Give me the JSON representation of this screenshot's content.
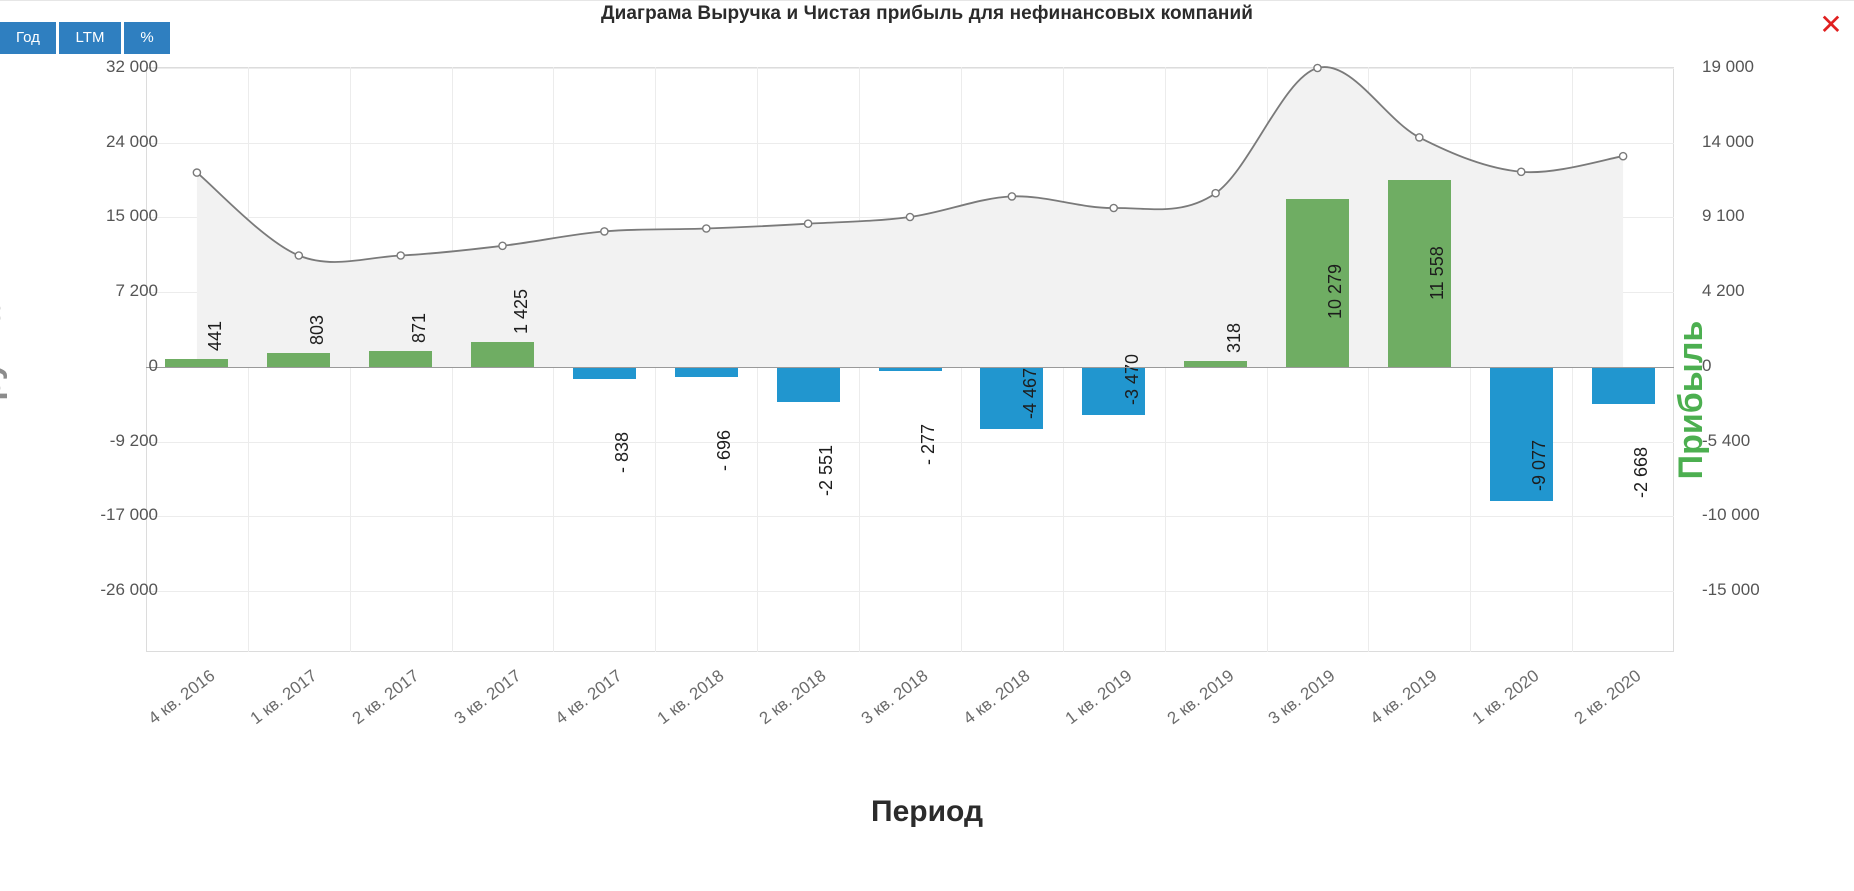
{
  "window": {
    "close_label": "✕"
  },
  "toolbar": {
    "buttons": [
      {
        "label": "Год"
      },
      {
        "label": "LTM"
      },
      {
        "label": "%"
      }
    ],
    "accent_color": "#2f7fc0"
  },
  "chart_data": {
    "type": "bar",
    "title": "Диаграма Выручка и Чистая прибыль для нефинансовых компаний",
    "xlabel": "Период",
    "ylabel": "Выручка",
    "ylabel_secondary": "Прибыль",
    "categories": [
      "4 кв. 2016",
      "1 кв. 2017",
      "2 кв. 2017",
      "3 кв. 2017",
      "4 кв. 2017",
      "1 кв. 2018",
      "2 кв. 2018",
      "3 кв. 2018",
      "4 кв. 2018",
      "1 кв. 2019",
      "2 кв. 2019",
      "3 кв. 2019",
      "4 кв. 2019",
      "1 кв. 2020",
      "2 кв. 2020"
    ],
    "ylim": [
      -26000,
      32000
    ],
    "yticks_left": [
      "32 000",
      "24 000",
      "15 000",
      "7 200",
      "0",
      "-9 200",
      "-17 000",
      "-26 000"
    ],
    "yticks_left_values": [
      32000,
      24000,
      15000,
      7200,
      0,
      -9200,
      -17000,
      -26000
    ],
    "ylim_secondary": [
      -15000,
      19000
    ],
    "yticks_right": [
      "19 000",
      "14 000",
      "9 100",
      "4 200",
      "0",
      "-5 400",
      "-10 000",
      "-15 000"
    ],
    "yticks_right_values": [
      19000,
      14000,
      9100,
      4200,
      0,
      -5400,
      -10000,
      -15000
    ],
    "grid": true,
    "legend": "none",
    "series": [
      {
        "name": "Прибыль",
        "type": "bar",
        "axis": "right",
        "positive_color": "#6fad63",
        "negative_color": "#2196cf",
        "values": [
          441,
          803,
          871,
          1425,
          -838,
          -696,
          -2551,
          -277,
          -4467,
          -3470,
          318,
          10279,
          11558,
          -9077,
          -2668
        ],
        "labels": [
          "441",
          "803",
          "871",
          "1 425",
          "- 838",
          "- 696",
          "-2 551",
          "- 277",
          "-4 467",
          "-3 470",
          "318",
          "10 279",
          "11 558",
          "-9 077",
          "-2 668"
        ]
      },
      {
        "name": "Выручка",
        "type": "area",
        "axis": "left",
        "line_color": "#7a7a7a",
        "fill_color": "#f2f2f2",
        "values": [
          20400,
          11000,
          11000,
          12000,
          13500,
          13800,
          14300,
          15000,
          17500,
          16100,
          17900,
          32500,
          24600,
          20500,
          22400
        ]
      }
    ]
  }
}
